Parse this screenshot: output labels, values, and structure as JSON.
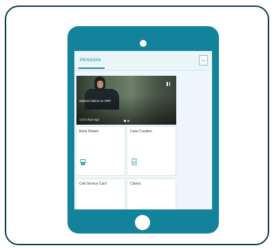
{
  "app": {
    "group_tab": {
      "label": "PENSION"
    },
    "dropdown": {
      "icon": "chevron-down-icon",
      "glyph": "⌄"
    },
    "hero_tile": {
      "title": "Submit Claims on HRP",
      "subtitle": "1413 days ago",
      "pause_icon": "pause-icon",
      "slides_total": 2,
      "active_slide": 1
    },
    "tiles": [
      {
        "label": "Bank Details",
        "icon": "people-icon"
      },
      {
        "label": "Case Creation",
        "icon": "document-icon"
      },
      {
        "label": "Civil Service Card",
        "icon": "card-icon"
      },
      {
        "label": "Claims",
        "icon": "claims-icon"
      }
    ]
  },
  "colors": {
    "tablet": "#12839a",
    "frame_border": "#0e3a4f",
    "accent": "#1a8aa3",
    "screen_bg": "#eef6f9"
  }
}
